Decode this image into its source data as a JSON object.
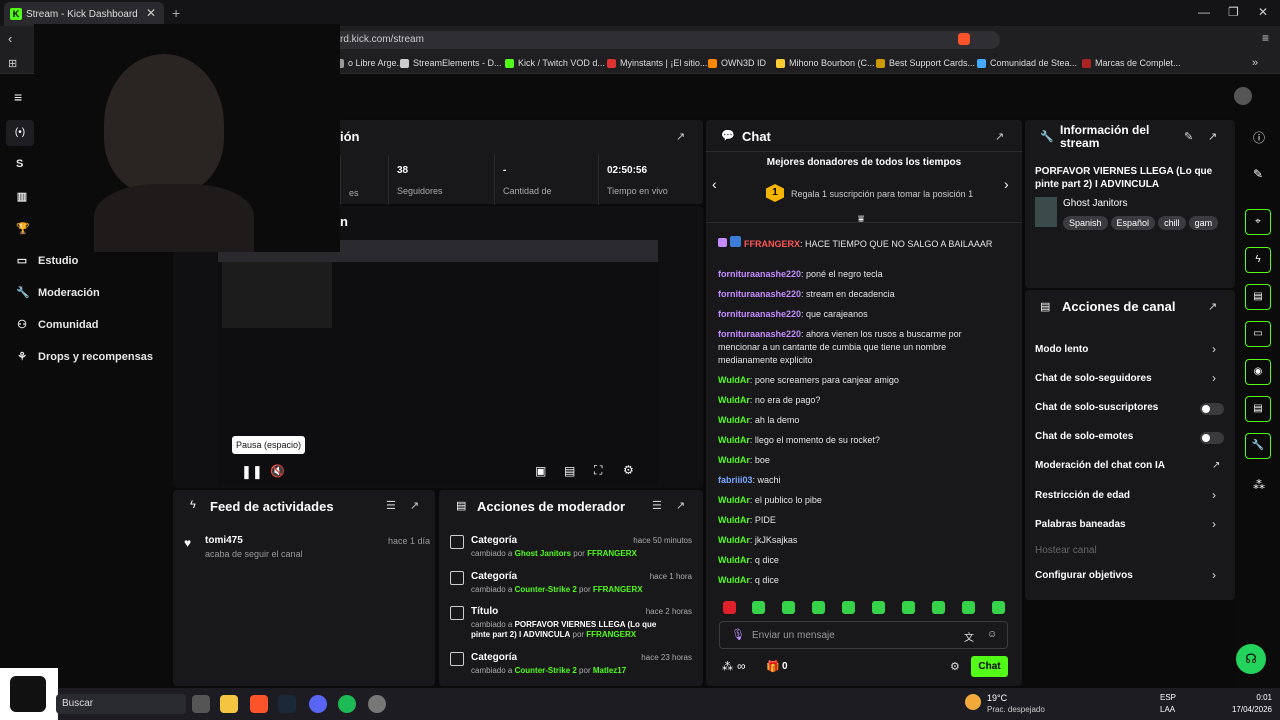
{
  "browser": {
    "tab_title": "Stream - Kick Dashboard",
    "url": "rd.kick.com/stream",
    "bookmarks": [
      "o Libre Arge...",
      "StreamElements - D...",
      "Kick / Twitch VOD d...",
      "Myinstants | ¡El sitio...",
      "OWN3D ID",
      "Mihono Bourbon (C...",
      "Best Support Cards...",
      "Comunidad de Stea...",
      "Marcas de Complet..."
    ]
  },
  "sidebar": {
    "items": [
      {
        "label": "S"
      },
      {
        "label": "Estudio"
      },
      {
        "label": "Moderación"
      },
      {
        "label": "Comunidad"
      },
      {
        "label": "Drops y recompensas"
      }
    ]
  },
  "stream_info_panel": {
    "title_fragment": "ión",
    "stats": [
      {
        "value": "",
        "label": "es"
      },
      {
        "value": "38",
        "label": "Seguidores"
      },
      {
        "value": "-",
        "label": "Cantidad de"
      },
      {
        "value": "02:50:56",
        "label": "Tiempo en vivo"
      }
    ],
    "sub_fragment": "n"
  },
  "player": {
    "tooltip": "Pausa (espacio)"
  },
  "feed": {
    "title": "Feed de actividades",
    "items": [
      {
        "user": "tomi475",
        "action": "acaba de seguir el canal",
        "time": "hace 1 día"
      }
    ]
  },
  "mod_actions": {
    "title": "Acciones de moderador",
    "items": [
      {
        "type": "Categoría",
        "time": "hace 50 minutos",
        "pre": "cambiado a ",
        "value": "Ghost Janitors",
        "by": " por ",
        "mod": "FFRANGERX"
      },
      {
        "type": "Categoría",
        "time": "hace 1 hora",
        "pre": "cambiado a ",
        "value": "Counter-Strike 2",
        "by": " por ",
        "mod": "FFRANGERX"
      },
      {
        "type": "Título",
        "time": "hace 2 horas",
        "pre": "cambiado a ",
        "value": "PORFAVOR VIERNES LLEGA (Lo que pinte part 2) I ADVINCULA",
        "by": " por ",
        "mod": "FFRANGERX"
      },
      {
        "type": "Categoría",
        "time": "hace 23 horas",
        "pre": "cambiado a ",
        "value": "Counter-Strike 2",
        "by": " por ",
        "mod": "Matlez17"
      }
    ]
  },
  "chat": {
    "title": "Chat",
    "donors_title": "Mejores donadores de todos los tiempos",
    "donor_rank": "1",
    "donor_text": "Regala 1 suscripción para tomar la posición 1",
    "messages": [
      {
        "user": "FFRANGERX",
        "text": ": HACE TIEMPO QUE NO SALGO A BAILAAAR",
        "style": "u4"
      },
      {
        "user": "fornituraanashe220",
        "text": ": poné el negro tecla",
        "style": "u1"
      },
      {
        "user": "fornituraanashe220",
        "text": ": stream en decadencia",
        "style": "u1"
      },
      {
        "user": "fornituraanashe220",
        "text": ": que carajeanos",
        "style": "u1"
      },
      {
        "user": "fornituraanashe220",
        "text": ": ahora vienen los rusos a buscarme por mencionar a un cantante de cumbia que tiene un nombre medianamente explicito",
        "style": "u1"
      },
      {
        "user": "WuldAr",
        "text": ": pone screamers para canjear amigo",
        "style": "u2"
      },
      {
        "user": "WuldAr",
        "text": ": no era de pago?",
        "style": "u2"
      },
      {
        "user": "WuldAr",
        "text": ": ah la demo",
        "style": "u2"
      },
      {
        "user": "WuldAr",
        "text": ": llego el momento de su rocket?",
        "style": "u2"
      },
      {
        "user": "WuldAr",
        "text": ": boe",
        "style": "u2"
      },
      {
        "user": "fabriii03",
        "text": ": wachi",
        "style": "u3"
      },
      {
        "user": "WuldAr",
        "text": ": el publico lo pibe",
        "style": "u2"
      },
      {
        "user": "WuldAr",
        "text": ": PIDE",
        "style": "u2"
      },
      {
        "user": "WuldAr",
        "text": ": jkJKsajkas",
        "style": "u2"
      },
      {
        "user": "WuldAr",
        "text": ": q dice",
        "style": "u2"
      },
      {
        "user": "WuldAr",
        "text": ": q dice",
        "style": "u2"
      }
    ],
    "input_placeholder": "Enviar un mensaje",
    "points": "0",
    "send_label": "Chat",
    "infinity": "∞"
  },
  "stream_details": {
    "title": "Información del stream",
    "stream_title": "PORFAVOR VIERNES LLEGA (Lo que pinte part 2) I ADVINCULA",
    "category": "Ghost Janitors",
    "tags": [
      "Spanish",
      "Español",
      "chill",
      "gam"
    ]
  },
  "channel_actions": {
    "title": "Acciones de canal",
    "items": [
      {
        "label": "Modo lento",
        "control": "chevron"
      },
      {
        "label": "Chat de solo-seguidores",
        "control": "chevron"
      },
      {
        "label": "Chat de solo-suscriptores",
        "control": "toggle"
      },
      {
        "label": "Chat de solo-emotes",
        "control": "toggle"
      },
      {
        "label": "Moderación del chat con IA",
        "control": "external"
      },
      {
        "label": "Restricción de edad",
        "control": "chevron"
      },
      {
        "label": "Palabras baneadas",
        "control": "chevron"
      },
      {
        "label": "Hostear canal",
        "control": "none"
      },
      {
        "label": "Configurar objetivos",
        "control": "chevron"
      }
    ]
  },
  "taskbar": {
    "search": "Buscar",
    "temp": "19°C",
    "weather": "Prac. despejado",
    "lang": "ESP",
    "region": "LAA",
    "time": "0:01",
    "date": "17/04/2026"
  }
}
